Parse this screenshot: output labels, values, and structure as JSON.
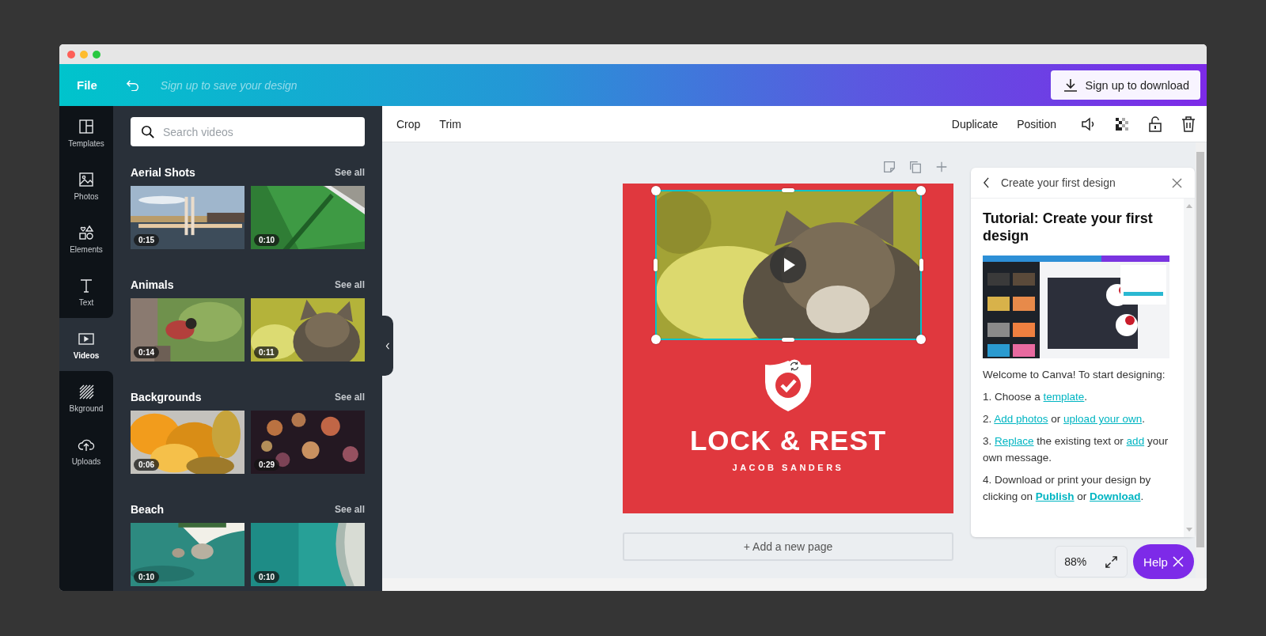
{
  "header": {
    "file_menu": "File",
    "save_hint": "Sign up to save your design",
    "download_button": "Sign up to download"
  },
  "sidebar": {
    "items": [
      {
        "label": "Templates",
        "selected": false
      },
      {
        "label": "Photos",
        "selected": false
      },
      {
        "label": "Elements",
        "selected": false
      },
      {
        "label": "Text",
        "selected": false
      },
      {
        "label": "Videos",
        "selected": true
      },
      {
        "label": "Bkground",
        "selected": false
      },
      {
        "label": "Uploads",
        "selected": false
      }
    ]
  },
  "panel": {
    "search": {
      "placeholder": "Search videos"
    },
    "sections": [
      {
        "title": "Aerial Shots",
        "see_all": "See all",
        "videos": [
          {
            "duration": "0:15"
          },
          {
            "duration": "0:10"
          }
        ]
      },
      {
        "title": "Animals",
        "see_all": "See all",
        "videos": [
          {
            "duration": "0:14"
          },
          {
            "duration": "0:11"
          }
        ]
      },
      {
        "title": "Backgrounds",
        "see_all": "See all",
        "videos": [
          {
            "duration": "0:06"
          },
          {
            "duration": "0:29"
          }
        ]
      },
      {
        "title": "Beach",
        "see_all": "See all",
        "videos": [
          {
            "duration": "0:10"
          },
          {
            "duration": "0:10"
          }
        ]
      }
    ]
  },
  "toolbar": {
    "left": [
      "Crop",
      "Trim"
    ],
    "right": [
      "Duplicate",
      "Position"
    ]
  },
  "design": {
    "title": "LOCK & REST",
    "subtitle": "JACOB SANDERS",
    "video_selected": true
  },
  "add_page": "+ Add a new page",
  "tutorial": {
    "header": "Create your first design",
    "title": "Tutorial: Create your first design",
    "intro": "Welcome to Canva! To start designing:",
    "steps": [
      [
        {
          "kind": "text",
          "text": "1. Choose a "
        },
        {
          "kind": "link",
          "text": "template"
        },
        {
          "kind": "text",
          "text": "."
        }
      ],
      [
        {
          "kind": "text",
          "text": "2. "
        },
        {
          "kind": "link",
          "text": "Add photos"
        },
        {
          "kind": "text",
          "text": " or "
        },
        {
          "kind": "link",
          "text": "upload your own"
        },
        {
          "kind": "text",
          "text": "."
        }
      ],
      [
        {
          "kind": "text",
          "text": "3. "
        },
        {
          "kind": "link",
          "text": "Replace"
        },
        {
          "kind": "text",
          "text": " the existing text or "
        },
        {
          "kind": "link",
          "text": "add"
        },
        {
          "kind": "text",
          "text": " your own message."
        }
      ],
      [
        {
          "kind": "text",
          "text": "4. Download or print your design by clicking on "
        },
        {
          "kind": "strong-link",
          "text": "Publish"
        },
        {
          "kind": "text",
          "text": " or "
        },
        {
          "kind": "strong-link",
          "text": "Download"
        },
        {
          "kind": "text",
          "text": "."
        }
      ]
    ]
  },
  "zoom": {
    "value": "88%"
  },
  "help_button": "Help"
}
